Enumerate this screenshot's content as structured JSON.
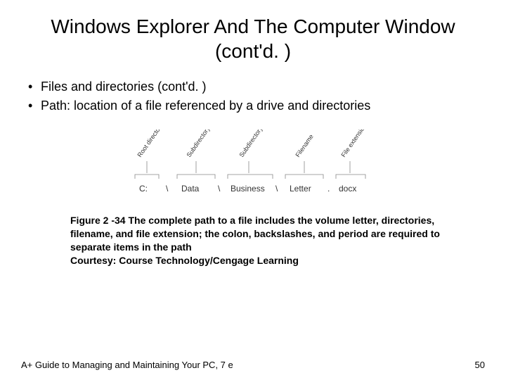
{
  "title": "Windows Explorer And The Computer Window (cont'd. )",
  "bullets": [
    "Files and directories (cont'd. )",
    "Path: location of a file referenced by a drive and directories"
  ],
  "diagram": {
    "labels": [
      "Root directory",
      "Subdirectory to root",
      "Subdirectory to data",
      "Filename",
      "File extension"
    ],
    "segments": [
      {
        "prefix": "",
        "text": "C:"
      },
      {
        "prefix": "\\",
        "text": "Data"
      },
      {
        "prefix": "\\",
        "text": "Business"
      },
      {
        "prefix": "\\",
        "text": "Letter"
      },
      {
        "prefix": ".",
        "text": "docx"
      }
    ]
  },
  "caption_lead": "Figure 2 -34",
  "caption_body": "The complete path to a file includes the volume letter, directories, filename, and file extension; the colon, backslashes, and period are required to separate items in the path",
  "caption_courtesy": "Courtesy: Course Technology/Cengage Learning",
  "footer_left": "A+ Guide to Managing and Maintaining Your PC, 7 e",
  "footer_right": "50"
}
